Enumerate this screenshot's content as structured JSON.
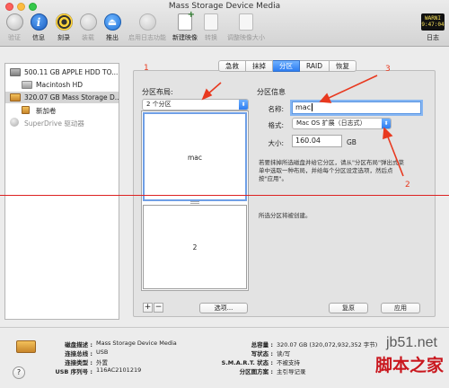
{
  "window": {
    "title": "Mass Storage Device Media"
  },
  "toolbar": {
    "verify": "验证",
    "info": "信息",
    "burn": "刻录",
    "mount": "装载",
    "eject": "推出",
    "journal": "启用日志功能",
    "new_image": "新建映像",
    "convert": "转换",
    "resize": "调整映像大小",
    "log": "日志",
    "log_icon_lines": [
      "WARNI",
      "9:47:04"
    ]
  },
  "sidebar": {
    "items": [
      {
        "label": "500.11 GB APPLE HDD TO..."
      },
      {
        "label": "Macintosh HD"
      },
      {
        "label": "320.07 GB Mass Storage D..."
      },
      {
        "label": "新加卷"
      },
      {
        "label": "SuperDrive 驱动器"
      }
    ]
  },
  "tabs": [
    "急救",
    "抹掉",
    "分区",
    "RAID",
    "恢复"
  ],
  "active_tab": "分区",
  "partition": {
    "layout_label": "分区布局:",
    "layout_value": "2 个分区",
    "info_label": "分区信息",
    "parts": [
      "mac",
      "2"
    ],
    "name_label": "名称:",
    "name_value": "mac",
    "format_label": "格式:",
    "format_value": "Mac OS 扩展（日志式）",
    "size_label": "大小:",
    "size_value": "160.04",
    "size_unit": "GB",
    "help_text": [
      "若要抹掉所选磁盘并给它分区，请从\"分区布局\"弹出式菜",
      "单中选取一种布局，并给每个分区设定选项，然后点",
      "按\"应用\"。"
    ],
    "status_text": "所选分区将被创建。",
    "add": "+",
    "remove": "−",
    "options_button": "选项...",
    "revert_button": "复原",
    "apply_button": "应用"
  },
  "annotations": {
    "a1": "1",
    "a2": "2",
    "a3": "3"
  },
  "bottom": {
    "desc_k": "磁盘描述 :",
    "desc_v": "Mass Storage Device Media",
    "bus_k": "连接总线 :",
    "bus_v": "USB",
    "type_k": "连接类型 :",
    "type_v": "外置",
    "serial_k": "USB 序列号 :",
    "serial_v": "116AC2101219",
    "capacity_k": "总容量 :",
    "capacity_v": "320.07 GB (320,072,932,352 字节)",
    "write_k": "写状态 :",
    "write_v": "读/写",
    "smart_k": "S.M.A.R.T. 状态 :",
    "smart_v": "不被支持",
    "scheme_k": "分区图方案 :",
    "scheme_v": "主引导记录",
    "help": "?"
  },
  "watermark": {
    "site": "jb51.net",
    "brand": "脚本之家"
  },
  "colors": {
    "accent": "#2d7df1",
    "annotation": "#e8391f"
  }
}
